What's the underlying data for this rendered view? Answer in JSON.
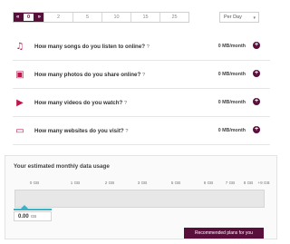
{
  "slider": {
    "left_arrow": "«",
    "right_arrow": "»",
    "selected": "0",
    "stops": [
      "2",
      "5",
      "10",
      "15",
      "25"
    ]
  },
  "period": {
    "selected": "Per Day",
    "caret": "▾"
  },
  "questions": [
    {
      "icon": "music-note-icon",
      "glyph": "♫",
      "text": "How many songs do you listen to online?",
      "help": "?",
      "value": "0 MB/month"
    },
    {
      "icon": "photos-icon",
      "glyph": "▣",
      "text": "How many photos do you share online?",
      "help": "?",
      "value": "0 MB/month"
    },
    {
      "icon": "video-icon",
      "glyph": "▶",
      "text": "How many videos do you watch?",
      "help": "?",
      "value": "0 MB/month"
    },
    {
      "icon": "website-icon",
      "glyph": "▭",
      "text": "How many websites do you visit?",
      "help": "?",
      "value": "0 MB/month"
    }
  ],
  "estimate": {
    "title": "Your estimated monthly data usage",
    "scale": [
      "0 GB",
      "1 GB",
      "2 GB",
      "3 GB",
      "5 GB",
      "6 GB",
      "7 GB",
      "8 GB",
      "+9 GB"
    ],
    "value": "0.00",
    "unit": "GB",
    "button": "Recommended plans for you"
  },
  "colors": {
    "accent": "#5a0e3b",
    "icon": "#c0144a",
    "marker": "#3bb3c7"
  }
}
